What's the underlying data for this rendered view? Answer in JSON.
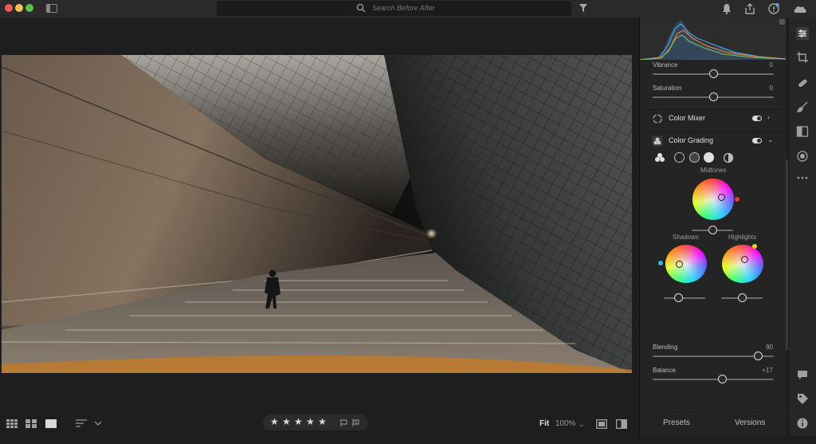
{
  "window": {
    "search_placeholder": "Search Before After"
  },
  "toolbar": {
    "fit_label": "Fit",
    "zoom_value": "100%",
    "icons": [
      "grid-view-icon",
      "square-grid-icon",
      "single-view-icon",
      "sort-icon",
      "filter-icon",
      "bell-icon",
      "share-icon",
      "info-icon",
      "cloud-icon"
    ]
  },
  "rating": {
    "stars": [
      "★",
      "★",
      "★",
      "★",
      "★"
    ],
    "value": 0
  },
  "edit_panel": {
    "sliders": {
      "vibrance": {
        "label": "Vibrance",
        "value": "0",
        "level": 0.5
      },
      "saturation": {
        "label": "Saturation",
        "value": "0",
        "level": 0.5
      }
    },
    "color_mixer": {
      "title": "Color Mixer",
      "enabled": true
    },
    "color_grading": {
      "title": "Color Grading",
      "enabled": true,
      "midtones_label": "Midtones",
      "shadows_label": "Shadows",
      "highlights_label": "Highlights",
      "blending": {
        "label": "Blending",
        "value": "90",
        "level": 0.9
      },
      "balance": {
        "label": "Balance",
        "value": "+17",
        "level": 0.585
      }
    }
  },
  "tabs": {
    "presets": "Presets",
    "versions": "Versions"
  },
  "colors": {
    "background": "#1e1e1e",
    "panel": "#242424",
    "midtone_dot": "#e23a3a",
    "shadow_dot": "#2fb8d8",
    "highlight_dot": "#e8d21c"
  }
}
